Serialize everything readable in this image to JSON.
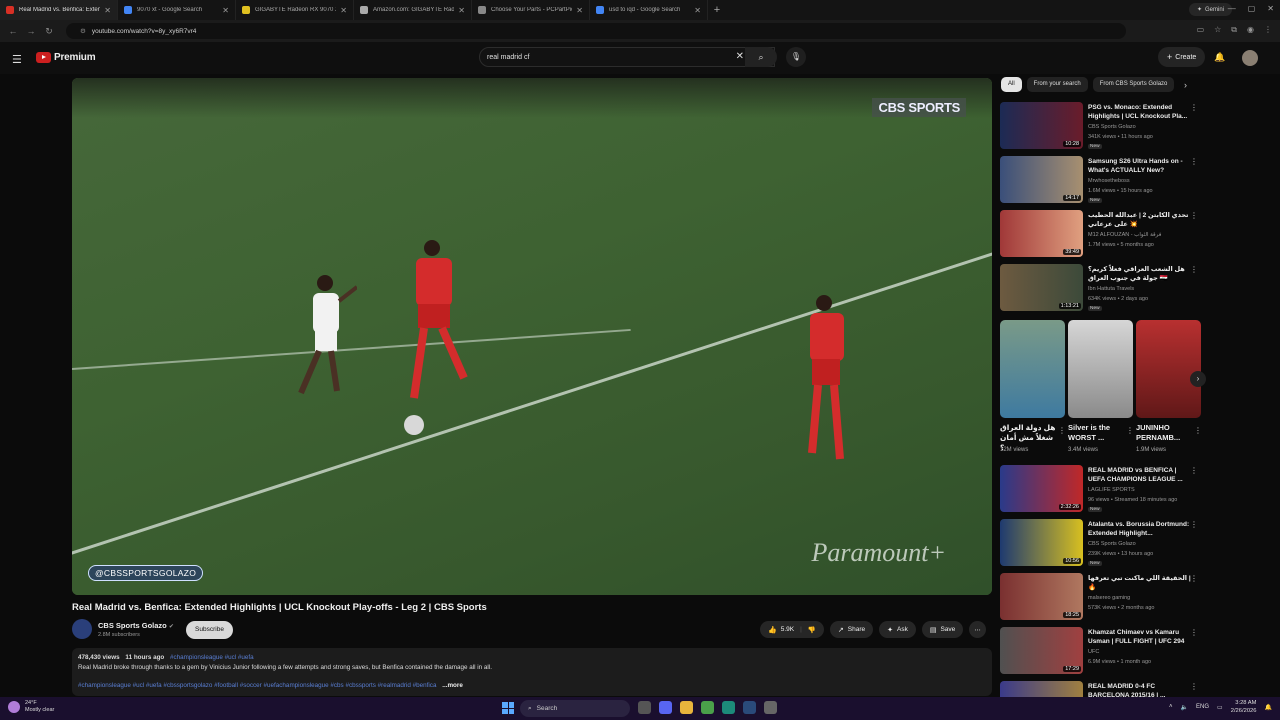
{
  "browser": {
    "tabs": [
      {
        "label": "Real Madrid vs. Benfica: Extended",
        "color": "#d93025",
        "active": true
      },
      {
        "label": "9070 xt - Google Search",
        "color": "#4285f4",
        "active": false
      },
      {
        "label": "GIGABYTE Radeon RX 9070 XT",
        "color": "#e0c020",
        "active": false
      },
      {
        "label": "Amazon.com: GIGABYTE Radeo",
        "color": "#aaaaaa",
        "active": false
      },
      {
        "label": "Choose Your Parts - PCPartPick",
        "color": "#888888",
        "active": false
      },
      {
        "label": "usd to iqd - Google Search",
        "color": "#4285f4",
        "active": false
      }
    ],
    "gemini_label": "Gemini",
    "url": "youtube.com/watch?v=8y_xy6R7vr4"
  },
  "youtube": {
    "logo_text": "Premium",
    "search_query": "real madrid cf",
    "create_label": "Create"
  },
  "video": {
    "cbs_logo": "CBS SPORTS",
    "handle": "@CBSSPORTSGOLAZO",
    "watermark": "Paramount+",
    "title": "Real Madrid vs. Benfica: Extended Highlights | UCL Knockout Play-offs - Leg 2 | CBS Sports",
    "channel": "CBS Sports Golazo",
    "subscribers": "2.8M subscribers",
    "subscribe_label": "Subscribe",
    "likes": "5.9K",
    "share_label": "Share",
    "ask_label": "Ask",
    "save_label": "Save",
    "views": "478,430 views",
    "age": "11 hours ago",
    "meta_tags": "#championsleague #ucl #uefa",
    "description": "Real Madrid broke through thanks to a gem by Vinicius Junior following a few attempts and strong saves, but Benfica contained the damage all in all.",
    "hashtags": "#championsleague #ucl #uefa #cbssportsgolazo #football #soccer #uefachampionsleague #cbs #cbssports #realmadrid #benfica",
    "more_label": "...more"
  },
  "sidebar": {
    "chips": [
      "All",
      "From your search",
      "From CBS Sports Golazo"
    ],
    "recs_top": [
      {
        "title": "PSG vs. Monaco: Extended Highlights | UCL Knockout Pla...",
        "channel": "CBS Sports Golazo",
        "meta": "341K views • 11 hours ago",
        "badge": "New",
        "duration": "10:28",
        "thumb": "linear-gradient(90deg,#1c2b55,#6a1c2a)"
      },
      {
        "title": "Samsung S26 Ultra Hands on - What's ACTUALLY New?",
        "channel": "Mrwhosetheboss",
        "meta": "1.6M views • 15 hours ago",
        "badge": "New",
        "duration": "14:17",
        "thumb": "linear-gradient(90deg,#3a4f7a,#a89070)"
      },
      {
        "title": "تحدي الكابتن 2 | عبدالله الحطيب 💥 على عزعاني",
        "channel": "M12 ALFOUZAN - فرقة الثواب",
        "meta": "1.7M views • 5 months ago",
        "badge": "",
        "duration": "39:49",
        "thumb": "linear-gradient(90deg,#a03838,#e0a080)"
      },
      {
        "title": "هل الشعب العراقي فعلاً كريم؟ جولة في جنوب العراق 🇮🇶",
        "channel": "Ibn Hattuta Travels",
        "meta": "634K views • 2 days ago",
        "badge": "New",
        "duration": "1:13:21",
        "thumb": "linear-gradient(90deg,#6d5a40,#3c4a3a)"
      }
    ],
    "shorts": [
      {
        "title": "هل دولة العراق شغلاً مش أمان ؟",
        "views": "12M views",
        "thumb": "linear-gradient(#7a9a88,#3e7aa0)"
      },
      {
        "title": "Silver is the WORST ...",
        "views": "3.4M views",
        "thumb": "linear-gradient(#d6d6d6,#8a8a8a)"
      },
      {
        "title": "JUNINHO PERNAMB...",
        "views": "1.9M views",
        "thumb": "linear-gradient(#b83030,#601818)"
      }
    ],
    "recs_bottom": [
      {
        "title": "REAL MADRID vs BENFICA | UEFA CHAMPIONS LEAGUE ...",
        "channel": "LAGLIFE SPORTS",
        "meta": "96 views • Streamed 18 minutes ago",
        "badge": "New",
        "duration": "2:32:26",
        "thumb": "linear-gradient(90deg,#2a3a8a,#c02828)"
      },
      {
        "title": "Atalanta vs. Borussia Dortmund: Extended Highlight...",
        "channel": "CBS Sports Golazo",
        "meta": "239K views • 13 hours ago",
        "badge": "New",
        "duration": "10:56",
        "thumb": "linear-gradient(90deg,#1e3a70,#d8c020)"
      },
      {
        "title": "الحقيقة اللي ماكنت تبي تعرفها | 🔥",
        "channel": "malsereo gaming",
        "meta": "573K views • 2 months ago",
        "badge": "",
        "duration": "18:25",
        "thumb": "linear-gradient(90deg,#7a3030,#b07860)"
      },
      {
        "title": "Khamzat Chimaev vs Kamaru Usman | FULL FIGHT | UFC 294",
        "channel": "UFC",
        "meta": "6.9M views • 1 month ago",
        "badge": "",
        "duration": "17:29",
        "thumb": "linear-gradient(90deg,#505050,#a04040)"
      },
      {
        "title": "REAL MADRID 0-4 FC BARCELONA 2015/16 | ...",
        "channel": "",
        "meta": "",
        "badge": "",
        "duration": "",
        "thumb": "linear-gradient(90deg,#3a3a8a,#a08040)"
      }
    ]
  },
  "taskbar": {
    "temp": "24°F",
    "weather": "Mostly clear",
    "search_placeholder": "Search",
    "lang": "ENG",
    "time": "3:28 AM",
    "date": "2/26/2026"
  }
}
